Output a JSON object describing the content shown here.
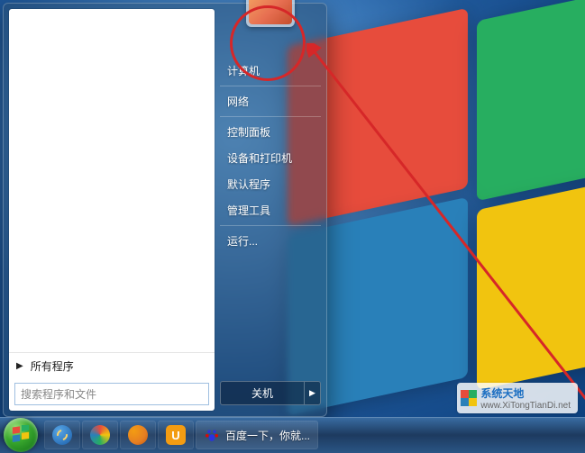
{
  "start_menu": {
    "all_programs_label": "所有程序",
    "search_placeholder": "搜索程序和文件",
    "right_items": [
      {
        "label": "计算机"
      },
      {
        "label": "网络"
      },
      {
        "label": "控制面板"
      },
      {
        "label": "设备和打印机"
      },
      {
        "label": "默认程序"
      },
      {
        "label": "管理工具"
      },
      {
        "label": "运行..."
      }
    ],
    "shutdown_label": "关机"
  },
  "taskbar": {
    "running_title": "百度一下，你就...",
    "uc_letter": "U"
  },
  "watermark": {
    "brand": "系统天地",
    "url": "www.XiTongTianDi.net"
  },
  "annotation": {
    "circle_color": "#d62728",
    "arrow_color": "#d62728"
  }
}
